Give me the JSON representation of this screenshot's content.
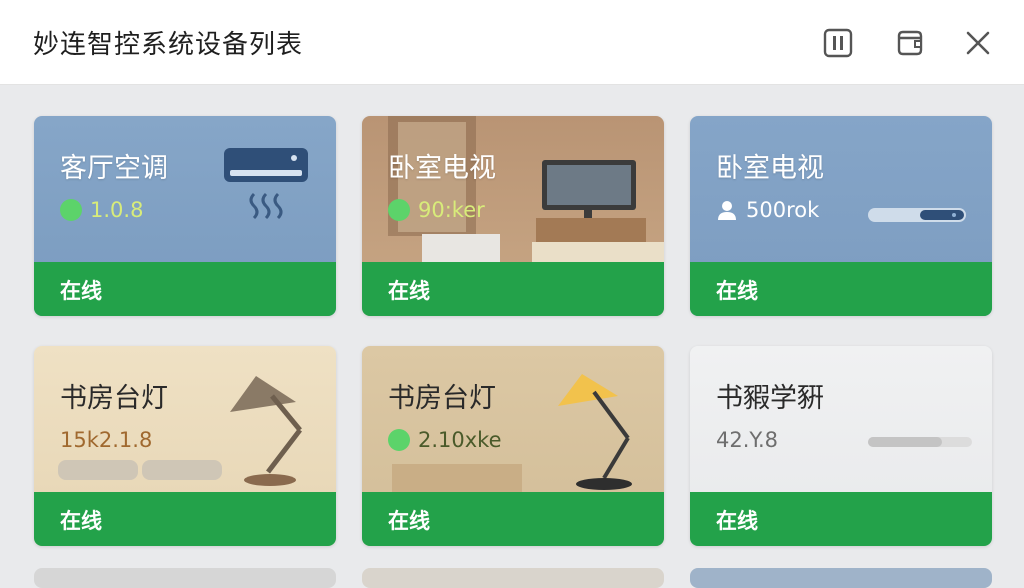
{
  "window": {
    "title": "妙连智控系统设备列表"
  },
  "devices": [
    {
      "name": "客厅空调",
      "value": "1.0.8",
      "status": "在线",
      "icon": "air-conditioner-icon"
    },
    {
      "name": "卧室电视",
      "value": "90:ker",
      "status": "在线",
      "icon": "television-icon"
    },
    {
      "name": "卧室电视",
      "value": "500rok",
      "status": "在线",
      "icon": "router-icon"
    },
    {
      "name": "书房台灯",
      "value": "15k2.1.8",
      "status": "在线",
      "icon": "desk-lamp-icon"
    },
    {
      "name": "书房台灯",
      "value": "2.10xke",
      "status": "在线",
      "icon": "desk-lamp-icon"
    },
    {
      "name": "书豭学豣",
      "value": "42.Y.8",
      "status": "在线",
      "icon": "slider-icon"
    }
  ],
  "colors": {
    "online_bar": "#23a24a",
    "online_dot": "#5cd36a",
    "card_blue": "#7e9fc2",
    "card_wood": "#b99a78",
    "card_beige": "#e6d6b8",
    "card_grey": "#eceef0"
  }
}
